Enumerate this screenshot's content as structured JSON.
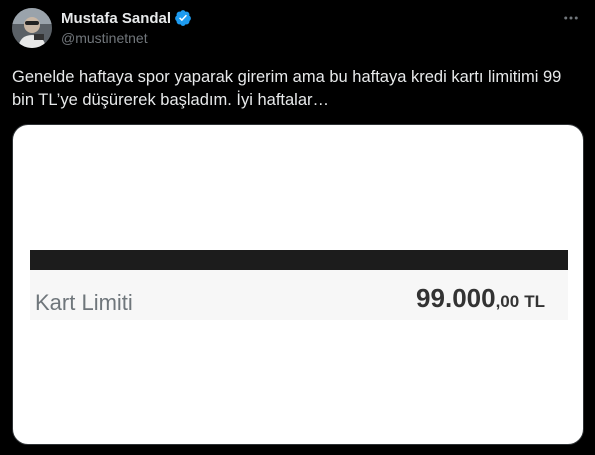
{
  "author": {
    "display_name": "Mustafa Sandal",
    "handle": "@mustinetnet",
    "verified_color": "#1d9bf0"
  },
  "tweet": {
    "text": "Genelde haftaya spor yaparak girerim ama bu haftaya kredi kartı limitimi 99 bin TL’ye düşürerek başladım. İyi haftalar…"
  },
  "media": {
    "label": "Kart Limiti",
    "amount_main": "99.000",
    "amount_decimal": ",00",
    "currency": "TL"
  },
  "icons": {
    "more": "more-icon",
    "verified": "verified-badge-icon"
  }
}
